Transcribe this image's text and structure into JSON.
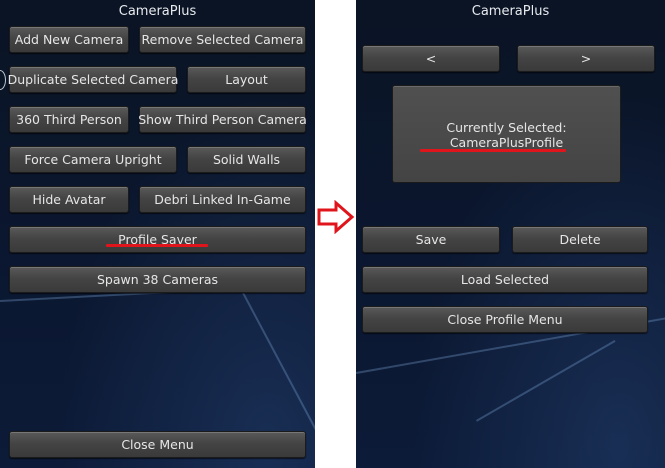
{
  "left": {
    "title": "CameraPlus",
    "buttons": {
      "add_new_camera": "Add New Camera",
      "remove_selected_camera": "Remove Selected Camera",
      "duplicate_selected_camera": "Duplicate Selected Camera",
      "layout": "Layout",
      "third_person_360": "360 Third Person",
      "show_third_person_camera": "Show Third Person Camera",
      "force_camera_upright": "Force Camera Upright",
      "solid_walls": "Solid Walls",
      "hide_avatar": "Hide Avatar",
      "debri_linked": "Debri Linked In-Game",
      "profile_saver": "Profile Saver",
      "spawn_cameras": "Spawn 38 Cameras",
      "close_menu": "Close Menu"
    }
  },
  "right": {
    "title": "CameraPlus",
    "buttons": {
      "prev": "<",
      "next": ">",
      "save": "Save",
      "delete": "Delete",
      "load_selected": "Load Selected",
      "close_profile_menu": "Close Profile Menu"
    },
    "currently_selected_label": "Currently Selected:",
    "currently_selected_value": "CameraPlusProfile"
  },
  "colors": {
    "highlight": "#e0141b",
    "arrow": "#e0141b"
  },
  "icons": {
    "transition": "right-arrow-icon"
  }
}
